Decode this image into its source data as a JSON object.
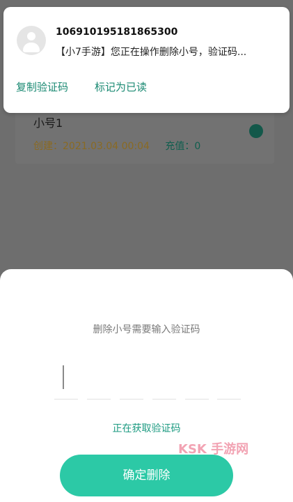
{
  "notification": {
    "sender": "106910195181865300",
    "message": "【小7手游】您正在操作删除小号，验证码...",
    "actions": {
      "copy_code": "复制验证码",
      "mark_read": "标记为已读"
    }
  },
  "account": {
    "name": "小号1",
    "created": "创建：2021.03.04 00:04",
    "recharge": "充值：0"
  },
  "sheet": {
    "prompt": "删除小号需要输入验证码",
    "code_value": "",
    "status": "正在获取验证码",
    "confirm_label": "确定删除"
  },
  "watermark": {
    "text": "KSK 手游网"
  },
  "colors": {
    "accent": "#2cc9a6",
    "accent_text": "#1b9a80",
    "overlay": "#6e6e6e",
    "watermark": "#f2a3b3"
  }
}
